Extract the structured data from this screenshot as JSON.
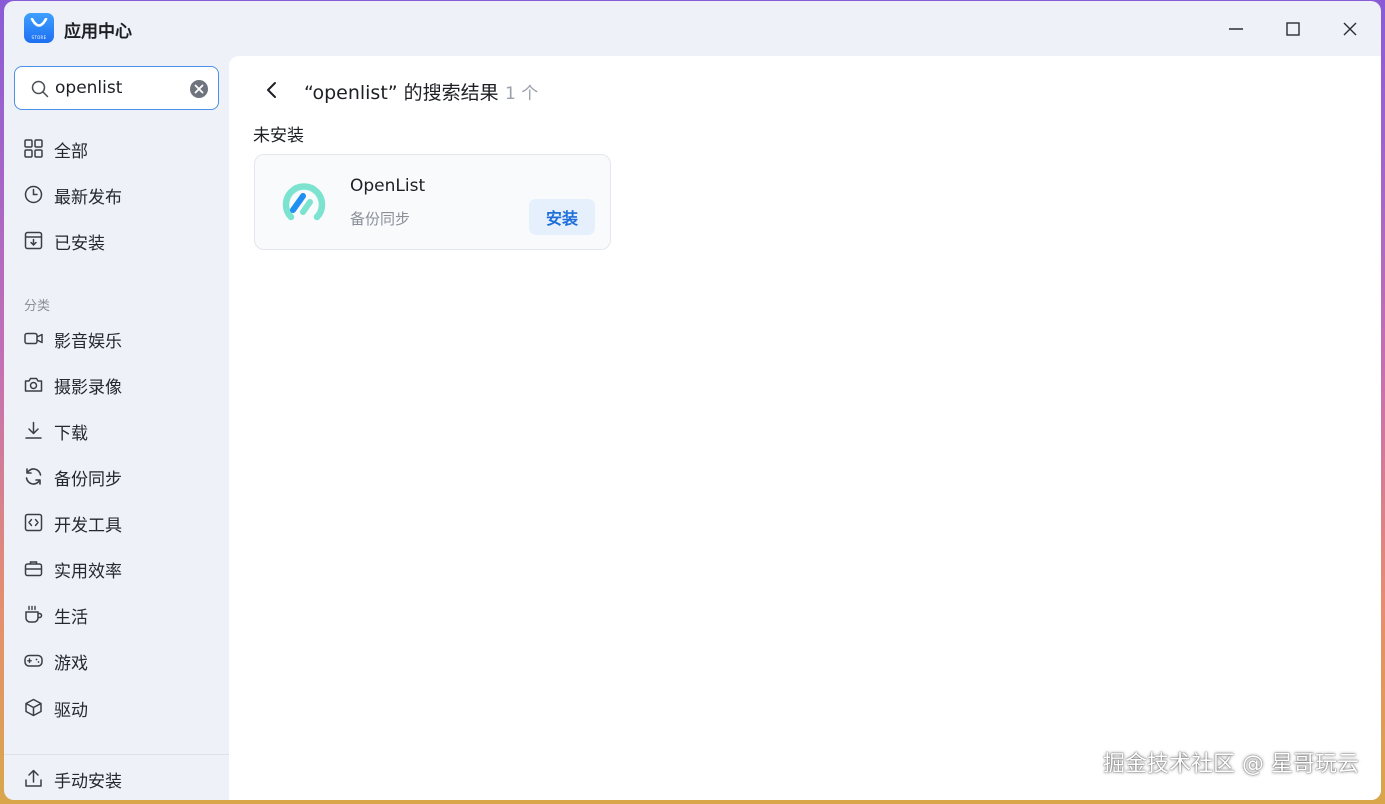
{
  "window": {
    "title": "应用中心",
    "logo_text": "STORE"
  },
  "search": {
    "value": "openlist",
    "placeholder": "搜索"
  },
  "sidebar": {
    "nav": [
      {
        "label": "全部",
        "icon": "grid-icon"
      },
      {
        "label": "最新发布",
        "icon": "clock-icon"
      },
      {
        "label": "已安装",
        "icon": "installed-box-icon"
      }
    ],
    "category_title": "分类",
    "categories": [
      {
        "label": "影音娱乐",
        "icon": "video-camera-icon"
      },
      {
        "label": "摄影录像",
        "icon": "camera-icon"
      },
      {
        "label": "下载",
        "icon": "download-icon"
      },
      {
        "label": "备份同步",
        "icon": "sync-icon"
      },
      {
        "label": "开发工具",
        "icon": "code-icon"
      },
      {
        "label": "实用效率",
        "icon": "briefcase-icon"
      },
      {
        "label": "生活",
        "icon": "coffee-cup-icon"
      },
      {
        "label": "游戏",
        "icon": "gamepad-icon"
      },
      {
        "label": "驱动",
        "icon": "cube-icon"
      }
    ],
    "manual_install": {
      "label": "手动安装",
      "icon": "upload-icon"
    }
  },
  "main": {
    "results_title": "“openlist” 的搜索结果",
    "results_count": "1 个",
    "section": "未安装",
    "apps": [
      {
        "name": "OpenList",
        "category": "备份同步",
        "action": "安装",
        "icon": "openlist-logo"
      }
    ]
  },
  "watermark": "掘金技术社区 @ 星哥玩云",
  "colors": {
    "accent": "#1e6fd9",
    "install_bg": "#e6f0fc",
    "sidebar_bg": "#eef1f7"
  }
}
